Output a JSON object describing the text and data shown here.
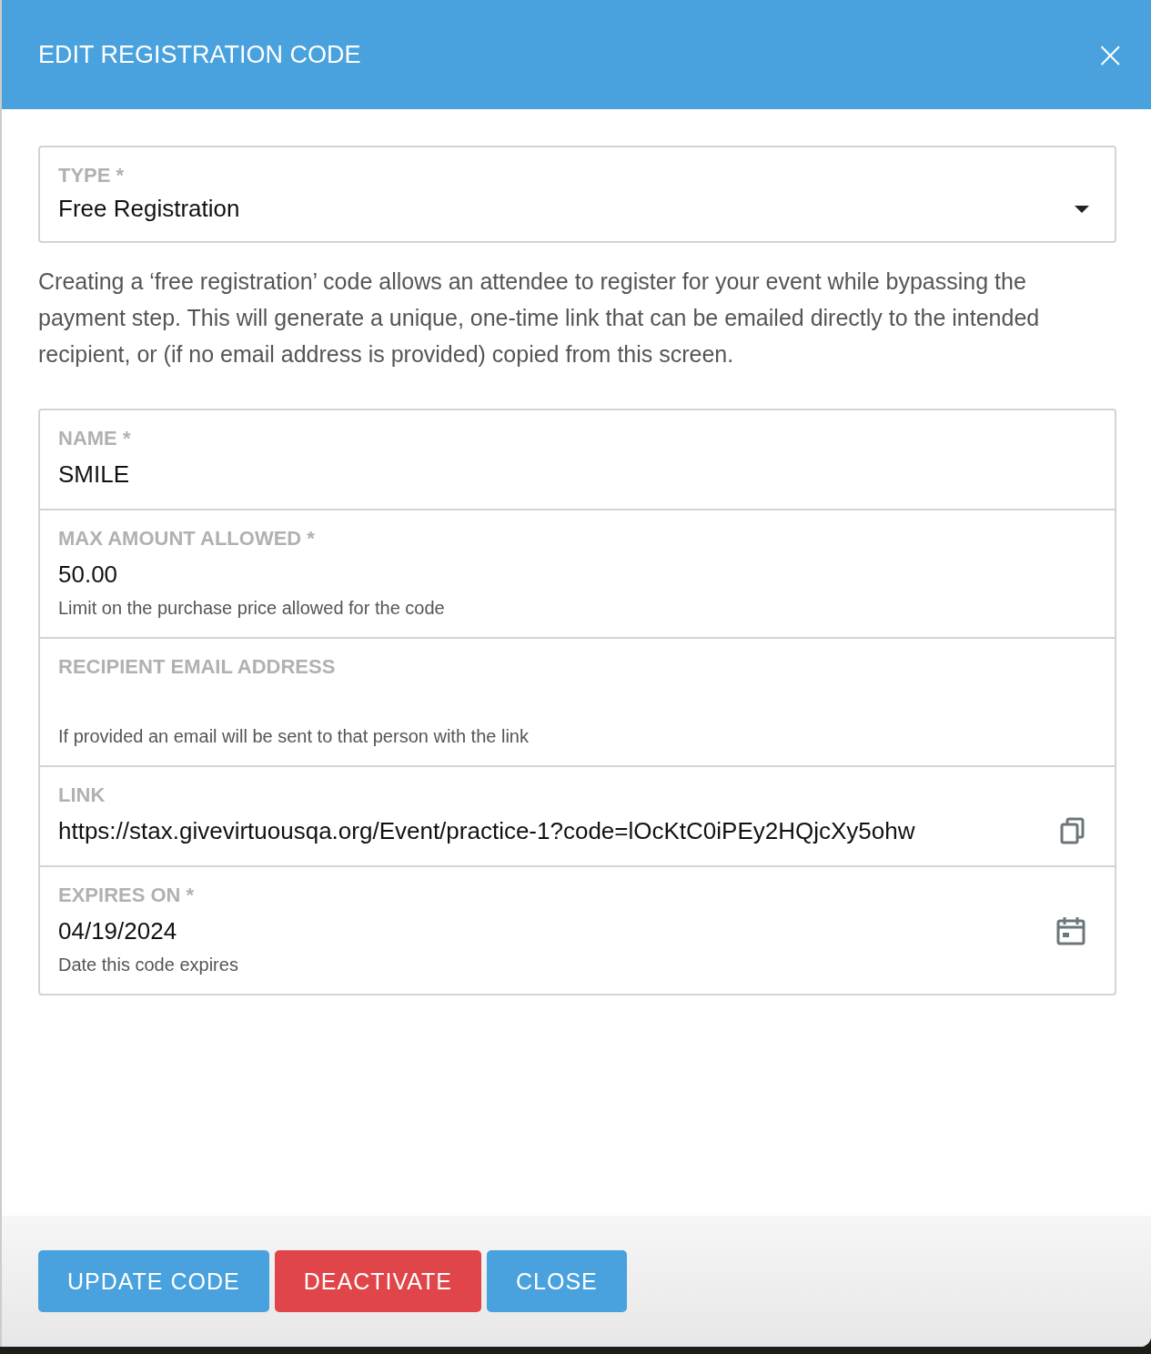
{
  "dialog": {
    "title": "EDIT REGISTRATION CODE",
    "close_icon": "×"
  },
  "type_field": {
    "label": "TYPE *",
    "value": "Free Registration"
  },
  "description": "Creating a ‘free registration’ code allows an attendee to register for your event while bypassing the payment step. This will generate a unique, one-time link that can be emailed directly to the intended recipient, or (if no email address is provided) copied from this screen.",
  "fields": [
    {
      "kind": "text",
      "label": "NAME *",
      "value": "SMILE"
    },
    {
      "kind": "text",
      "label": "MAX AMOUNT ALLOWED *",
      "value": "50.00",
      "hint": "Limit on the purchase price allowed for the code"
    },
    {
      "kind": "text",
      "label": "RECIPIENT EMAIL ADDRESS",
      "hint": "If provided an email will be sent to that person with the link"
    },
    {
      "kind": "link",
      "label": "LINK",
      "value": "https://stax.givevirtuousqa.org/Event/practice-1?code=lOcKtC0iPEy2HQjcXy5ohw"
    },
    {
      "kind": "date",
      "label": "EXPIRES ON *",
      "value": "04/19/2024",
      "hint": "Date this code expires"
    }
  ],
  "buttons": [
    {
      "kind": "primary",
      "label": "UPDATE CODE"
    },
    {
      "kind": "danger",
      "label": "DEACTIVATE"
    },
    {
      "kind": "primary",
      "label": "CLOSE"
    }
  ]
}
